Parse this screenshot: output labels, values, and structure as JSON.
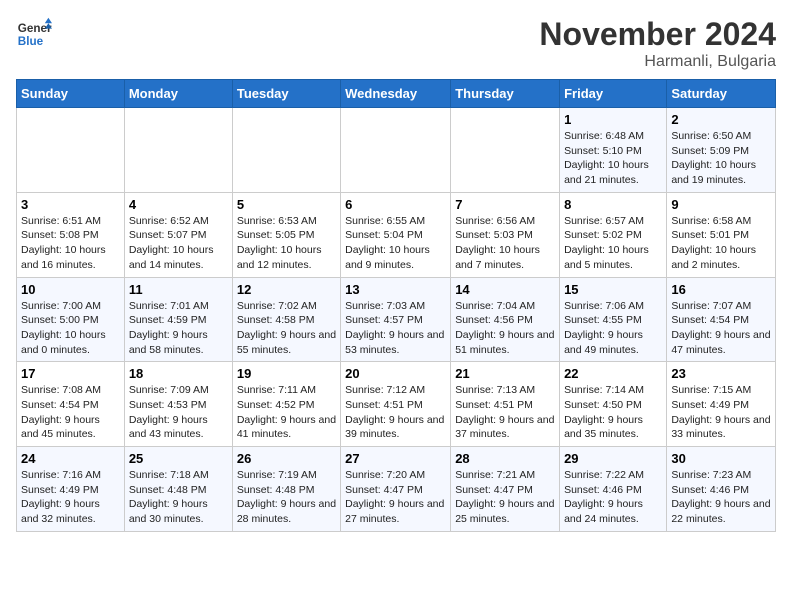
{
  "header": {
    "logo_general": "General",
    "logo_blue": "Blue",
    "month": "November 2024",
    "location": "Harmanli, Bulgaria"
  },
  "weekdays": [
    "Sunday",
    "Monday",
    "Tuesday",
    "Wednesday",
    "Thursday",
    "Friday",
    "Saturday"
  ],
  "weeks": [
    [
      {
        "day": "",
        "info": ""
      },
      {
        "day": "",
        "info": ""
      },
      {
        "day": "",
        "info": ""
      },
      {
        "day": "",
        "info": ""
      },
      {
        "day": "",
        "info": ""
      },
      {
        "day": "1",
        "info": "Sunrise: 6:48 AM\nSunset: 5:10 PM\nDaylight: 10 hours and 21 minutes."
      },
      {
        "day": "2",
        "info": "Sunrise: 6:50 AM\nSunset: 5:09 PM\nDaylight: 10 hours and 19 minutes."
      }
    ],
    [
      {
        "day": "3",
        "info": "Sunrise: 6:51 AM\nSunset: 5:08 PM\nDaylight: 10 hours and 16 minutes."
      },
      {
        "day": "4",
        "info": "Sunrise: 6:52 AM\nSunset: 5:07 PM\nDaylight: 10 hours and 14 minutes."
      },
      {
        "day": "5",
        "info": "Sunrise: 6:53 AM\nSunset: 5:05 PM\nDaylight: 10 hours and 12 minutes."
      },
      {
        "day": "6",
        "info": "Sunrise: 6:55 AM\nSunset: 5:04 PM\nDaylight: 10 hours and 9 minutes."
      },
      {
        "day": "7",
        "info": "Sunrise: 6:56 AM\nSunset: 5:03 PM\nDaylight: 10 hours and 7 minutes."
      },
      {
        "day": "8",
        "info": "Sunrise: 6:57 AM\nSunset: 5:02 PM\nDaylight: 10 hours and 5 minutes."
      },
      {
        "day": "9",
        "info": "Sunrise: 6:58 AM\nSunset: 5:01 PM\nDaylight: 10 hours and 2 minutes."
      }
    ],
    [
      {
        "day": "10",
        "info": "Sunrise: 7:00 AM\nSunset: 5:00 PM\nDaylight: 10 hours and 0 minutes."
      },
      {
        "day": "11",
        "info": "Sunrise: 7:01 AM\nSunset: 4:59 PM\nDaylight: 9 hours and 58 minutes."
      },
      {
        "day": "12",
        "info": "Sunrise: 7:02 AM\nSunset: 4:58 PM\nDaylight: 9 hours and 55 minutes."
      },
      {
        "day": "13",
        "info": "Sunrise: 7:03 AM\nSunset: 4:57 PM\nDaylight: 9 hours and 53 minutes."
      },
      {
        "day": "14",
        "info": "Sunrise: 7:04 AM\nSunset: 4:56 PM\nDaylight: 9 hours and 51 minutes."
      },
      {
        "day": "15",
        "info": "Sunrise: 7:06 AM\nSunset: 4:55 PM\nDaylight: 9 hours and 49 minutes."
      },
      {
        "day": "16",
        "info": "Sunrise: 7:07 AM\nSunset: 4:54 PM\nDaylight: 9 hours and 47 minutes."
      }
    ],
    [
      {
        "day": "17",
        "info": "Sunrise: 7:08 AM\nSunset: 4:54 PM\nDaylight: 9 hours and 45 minutes."
      },
      {
        "day": "18",
        "info": "Sunrise: 7:09 AM\nSunset: 4:53 PM\nDaylight: 9 hours and 43 minutes."
      },
      {
        "day": "19",
        "info": "Sunrise: 7:11 AM\nSunset: 4:52 PM\nDaylight: 9 hours and 41 minutes."
      },
      {
        "day": "20",
        "info": "Sunrise: 7:12 AM\nSunset: 4:51 PM\nDaylight: 9 hours and 39 minutes."
      },
      {
        "day": "21",
        "info": "Sunrise: 7:13 AM\nSunset: 4:51 PM\nDaylight: 9 hours and 37 minutes."
      },
      {
        "day": "22",
        "info": "Sunrise: 7:14 AM\nSunset: 4:50 PM\nDaylight: 9 hours and 35 minutes."
      },
      {
        "day": "23",
        "info": "Sunrise: 7:15 AM\nSunset: 4:49 PM\nDaylight: 9 hours and 33 minutes."
      }
    ],
    [
      {
        "day": "24",
        "info": "Sunrise: 7:16 AM\nSunset: 4:49 PM\nDaylight: 9 hours and 32 minutes."
      },
      {
        "day": "25",
        "info": "Sunrise: 7:18 AM\nSunset: 4:48 PM\nDaylight: 9 hours and 30 minutes."
      },
      {
        "day": "26",
        "info": "Sunrise: 7:19 AM\nSunset: 4:48 PM\nDaylight: 9 hours and 28 minutes."
      },
      {
        "day": "27",
        "info": "Sunrise: 7:20 AM\nSunset: 4:47 PM\nDaylight: 9 hours and 27 minutes."
      },
      {
        "day": "28",
        "info": "Sunrise: 7:21 AM\nSunset: 4:47 PM\nDaylight: 9 hours and 25 minutes."
      },
      {
        "day": "29",
        "info": "Sunrise: 7:22 AM\nSunset: 4:46 PM\nDaylight: 9 hours and 24 minutes."
      },
      {
        "day": "30",
        "info": "Sunrise: 7:23 AM\nSunset: 4:46 PM\nDaylight: 9 hours and 22 minutes."
      }
    ]
  ]
}
